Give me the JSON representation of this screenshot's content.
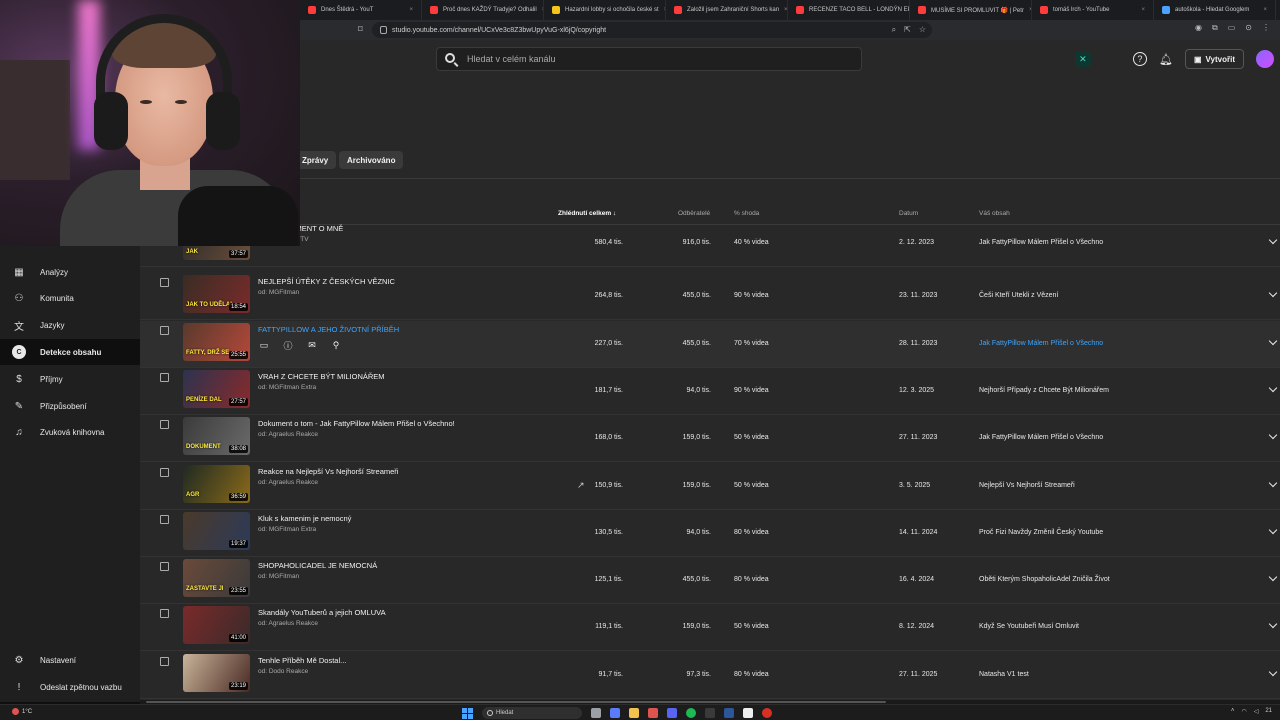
{
  "browser": {
    "tabs": [
      {
        "label": "Dnes Štědrá - YouT",
        "color": "#ff3b3b"
      },
      {
        "label": "Proč dnes KAŽDÝ Tradyje? Odhalil",
        "color": "#ff3b3b"
      },
      {
        "label": "Hazardní lobby si ochočila české st",
        "color": "#f5c518"
      },
      {
        "label": "Založil jsem Zahraniční Shorts kan",
        "color": "#ff3b3b"
      },
      {
        "label": "RECENZE TACO BELL - LONDÝN EP",
        "color": "#ff3b3b"
      },
      {
        "label": "MUSÍME SI PROMLUVIT 🎁 | Petr",
        "color": "#ff3b3b"
      },
      {
        "label": "tomáš lrch - YouTube",
        "color": "#ff3b3b"
      },
      {
        "label": "autoškola - Hledat Googlem",
        "color": "#4aa3ff"
      }
    ],
    "url": "studio.youtube.com/channel/UCxVe3c8Z3bwUpyVuG-xl6jQ/copyright"
  },
  "header": {
    "search_placeholder": "Hledat v celém kanálu",
    "create_label": "Vytvořit"
  },
  "sidebar": {
    "items": [
      {
        "label": "Analýzy",
        "icon": "analytics-icon"
      },
      {
        "label": "Komunita",
        "icon": "community-icon"
      },
      {
        "label": "Jazyky",
        "icon": "languages-icon"
      },
      {
        "label": "Detekce obsahu",
        "icon": "content-detection-icon",
        "active": true
      },
      {
        "label": "Příjmy",
        "icon": "earn-icon"
      },
      {
        "label": "Přizpůsobení",
        "icon": "customization-icon"
      },
      {
        "label": "Zvuková knihovna",
        "icon": "audio-library-icon"
      }
    ],
    "bottom": [
      {
        "label": "Nastavení",
        "icon": "settings-icon"
      },
      {
        "label": "Odeslat zpětnou vazbu",
        "icon": "feedback-icon"
      }
    ]
  },
  "chips": [
    "Zprávy",
    "Archivováno"
  ],
  "table": {
    "headers": {
      "views": "Zhlédnutí celkem",
      "subs": "Odběratelé",
      "match": "% shoda",
      "date": "Datum",
      "content": "Váš obsah"
    },
    "rows": [
      {
        "title": "MINIDOKUMENT O MNĚ",
        "sub": "od: FattyPillowTV",
        "duration": "37:57",
        "views": "580,4 tis.",
        "subs": "916,0 tis.",
        "match": "40 % videa",
        "date": "2. 12. 2023",
        "content": "Jak FattyPillow Málem Přišel o Všechno",
        "thumb": [
          "#2a2a2a",
          "#6b4e3a"
        ],
        "cap": "JAK"
      },
      {
        "title": "NEJLEPŠÍ ÚTĚKY Z ČESKÝCH VĚZNIC",
        "sub": "od: MGFitman",
        "duration": "18:54",
        "views": "264,8 tis.",
        "subs": "455,0 tis.",
        "match": "90 % videa",
        "date": "23. 11. 2023",
        "content": "Češi Kteří Utekli z Vězení",
        "thumb": [
          "#3a2c24",
          "#7a2b2b"
        ],
        "cap": "JAK TO UDĚLAL"
      },
      {
        "title": "FATTYPILLOW A JEHO ŽIVOTNÍ PŘÍBĚH",
        "sub": "",
        "duration": "25:55",
        "views": "227,0 tis.",
        "subs": "455,0 tis.",
        "match": "70 % videa",
        "date": "28. 11. 2023",
        "content": "Jak FattyPillow Málem Přišel o Všechno",
        "thumb": [
          "#5a3a2c",
          "#b3483a"
        ],
        "cap": "FATTY, DRŽ SE",
        "hover": true
      },
      {
        "title": "VRAH Z CHCETE BÝT MILIONÁŘEM",
        "sub": "od: MGFitman Extra",
        "duration": "27:57",
        "views": "181,7 tis.",
        "subs": "94,0 tis.",
        "match": "90 % videa",
        "date": "12. 3. 2025",
        "content": "Nejhorší Případy z Chcete Být Milionářem",
        "thumb": [
          "#2b3350",
          "#8a2a2a"
        ],
        "cap": "PENÍZE DAL"
      },
      {
        "title": "Dokument o tom - Jak FattyPillow Málem Přišel o Všechno!",
        "sub": "od: Agraelus Reakce",
        "duration": "38:08",
        "views": "168,0 tis.",
        "subs": "159,0 tis.",
        "match": "50 % videa",
        "date": "27. 11. 2023",
        "content": "Jak FattyPillow Málem Přišel o Všechno",
        "thumb": [
          "#3b3b3b",
          "#6a6a6a"
        ],
        "cap": "DOKUMENT"
      },
      {
        "title": "Reakce na Nejlepší Vs Nejhorší Streameři",
        "sub": "od: Agraelus Reakce",
        "duration": "36:59",
        "views": "150,9 tis.",
        "subs": "159,0 tis.",
        "match": "50 % videa",
        "date": "3. 5. 2025",
        "content": "Nejlepší Vs Nejhorší Streameři",
        "thumb": [
          "#1f2a22",
          "#8a6a1a"
        ],
        "cap": "AGR",
        "trend": true
      },
      {
        "title": "Kluk s kamenim je nemocný",
        "sub": "od: MGFitman Extra",
        "duration": "19:37",
        "views": "130,5 tis.",
        "subs": "94,0 tis.",
        "match": "80 % videa",
        "date": "14. 11. 2024",
        "content": "Proč Fizi Navždy Změnil Český Youtube",
        "thumb": [
          "#4a3a2a",
          "#2c3a5a"
        ],
        "cap": ""
      },
      {
        "title": "SHOPAHOLICADEL JE NEMOCNÁ",
        "sub": "od: MGFitman",
        "duration": "23:55",
        "views": "125,1 tis.",
        "subs": "455,0 tis.",
        "match": "80 % videa",
        "date": "16. 4. 2024",
        "content": "Oběti Kterým ShopaholicAdel Zničila Život",
        "thumb": [
          "#6a4a3a",
          "#3a3a3a"
        ],
        "cap": "ZASTAVTE JI"
      },
      {
        "title": "Skandály YouTuberů a jejich OMLUVA",
        "sub": "od: Agraelus Reakce",
        "duration": "41:00",
        "views": "119,1 tis.",
        "subs": "159,0 tis.",
        "match": "50 % videa",
        "date": "8. 12. 2024",
        "content": "Když Se Youtubeři Musí Omluvit",
        "thumb": [
          "#7a2a2a",
          "#3a2a2a"
        ],
        "cap": ""
      },
      {
        "title": "Tenhle Příběh Mě Dostal...",
        "sub": "od: Dodo Reakce",
        "duration": "23:19",
        "views": "91,7 tis.",
        "subs": "97,3 tis.",
        "match": "80 % videa",
        "date": "27. 11. 2025",
        "content": "Natasha V1 test",
        "thumb": [
          "#c9b49a",
          "#4a2a24"
        ],
        "cap": ""
      }
    ]
  },
  "taskbar": {
    "weather": "1°C",
    "search_label": "Hledat",
    "clock": "21"
  }
}
